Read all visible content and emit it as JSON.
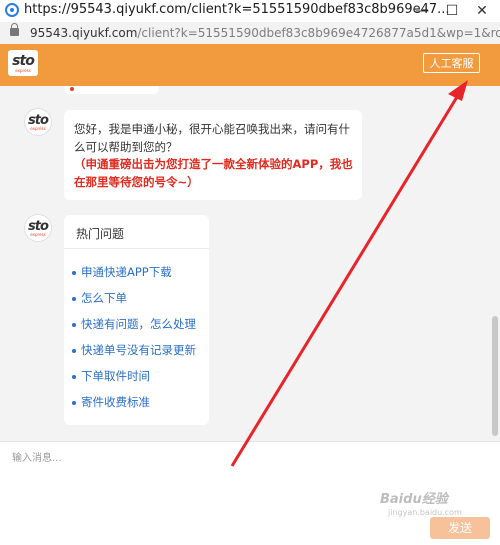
{
  "window": {
    "title": "https://95543.qiyukf.com/client?k=51551590dbef83c8b969e47...",
    "minimize": "—",
    "maximize": "☐",
    "close": "✕"
  },
  "address_bar": {
    "host": "95543.qiyukf.com",
    "path": "/client?k=51551590dbef83c8b969e4726877a5d1&wp=1&rob..."
  },
  "header": {
    "logo_text": "sto",
    "logo_sub": "express",
    "human_service_button": "人工客服"
  },
  "messages": {
    "greeting": {
      "avatar_text": "sto",
      "avatar_sub": "express",
      "text": "您好，我是申通小秘，很开心能召唤我出来，请问有什么可以帮助到您的？",
      "promo": "（申通重磅出击为您打造了一款全新体验的APP，我也在那里等待您的号令~）"
    },
    "faq": {
      "avatar_text": "sto",
      "avatar_sub": "express",
      "title": "热门问题",
      "items": [
        "申通快递APP下载",
        "怎么下单",
        "快递有问题，怎么处理",
        "快递单号没有记录更新",
        "下单取件时间",
        "寄件收费标准"
      ]
    }
  },
  "input": {
    "placeholder": "输入消息...",
    "value": ""
  },
  "send_button": "发送",
  "watermark": {
    "text": "Baidu经验",
    "sub": "jingyan.baidu.com"
  },
  "colors": {
    "header": "#f19a3e",
    "promo": "#e22a1f",
    "link": "#2a6fc9",
    "annotation_arrow": "#e8232a",
    "send_button": "#f7c29a"
  }
}
